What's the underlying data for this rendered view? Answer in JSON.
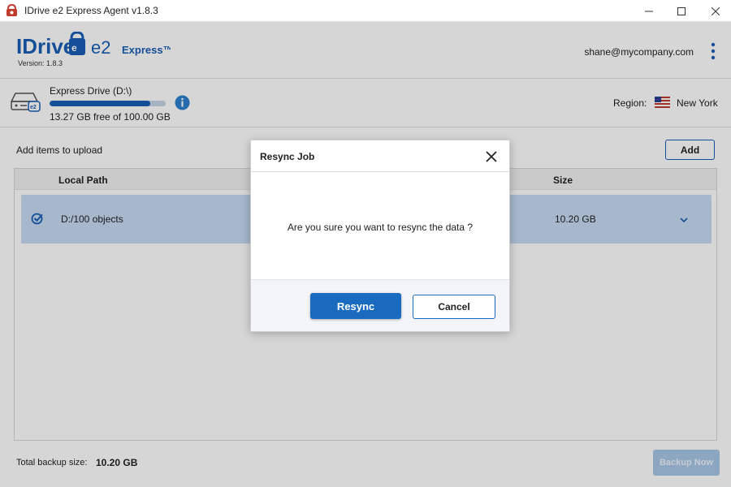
{
  "window": {
    "title": "IDrive e2 Express Agent v1.8.3",
    "controls": [
      "minimize-icon",
      "maximize-icon",
      "close-icon"
    ]
  },
  "header": {
    "logo_text": "IDrive",
    "logo_e2": "e2",
    "logo_product": "Express™",
    "version": "Version: 1.8.3",
    "user_email": "shane@mycompany.com"
  },
  "drive": {
    "name": "Express Drive (D:\\)",
    "free_text": "13.27 GB free of 100.00 GB",
    "used_fraction": 0.867,
    "region_label": "Region:",
    "region_value": "New York"
  },
  "upload": {
    "add_label": "Add items to upload",
    "add_button": "Add"
  },
  "table": {
    "columns": [
      "Local Path",
      "Size"
    ],
    "rows": [
      {
        "path": "D:/100 objects",
        "size": "10.20 GB",
        "selected": true
      }
    ]
  },
  "footer": {
    "total_label": "Total backup size:",
    "total_value": "10.20 GB",
    "backup_button": "Backup Now"
  },
  "dialog": {
    "title": "Resync Job",
    "message": "Are you sure you want to resync the data ?",
    "primary_button": "Resync",
    "secondary_button": "Cancel"
  },
  "colors": {
    "accent": "#1a6bbf",
    "selected_row": "#c7daf3",
    "logo_blue": "#1a5fb4"
  }
}
